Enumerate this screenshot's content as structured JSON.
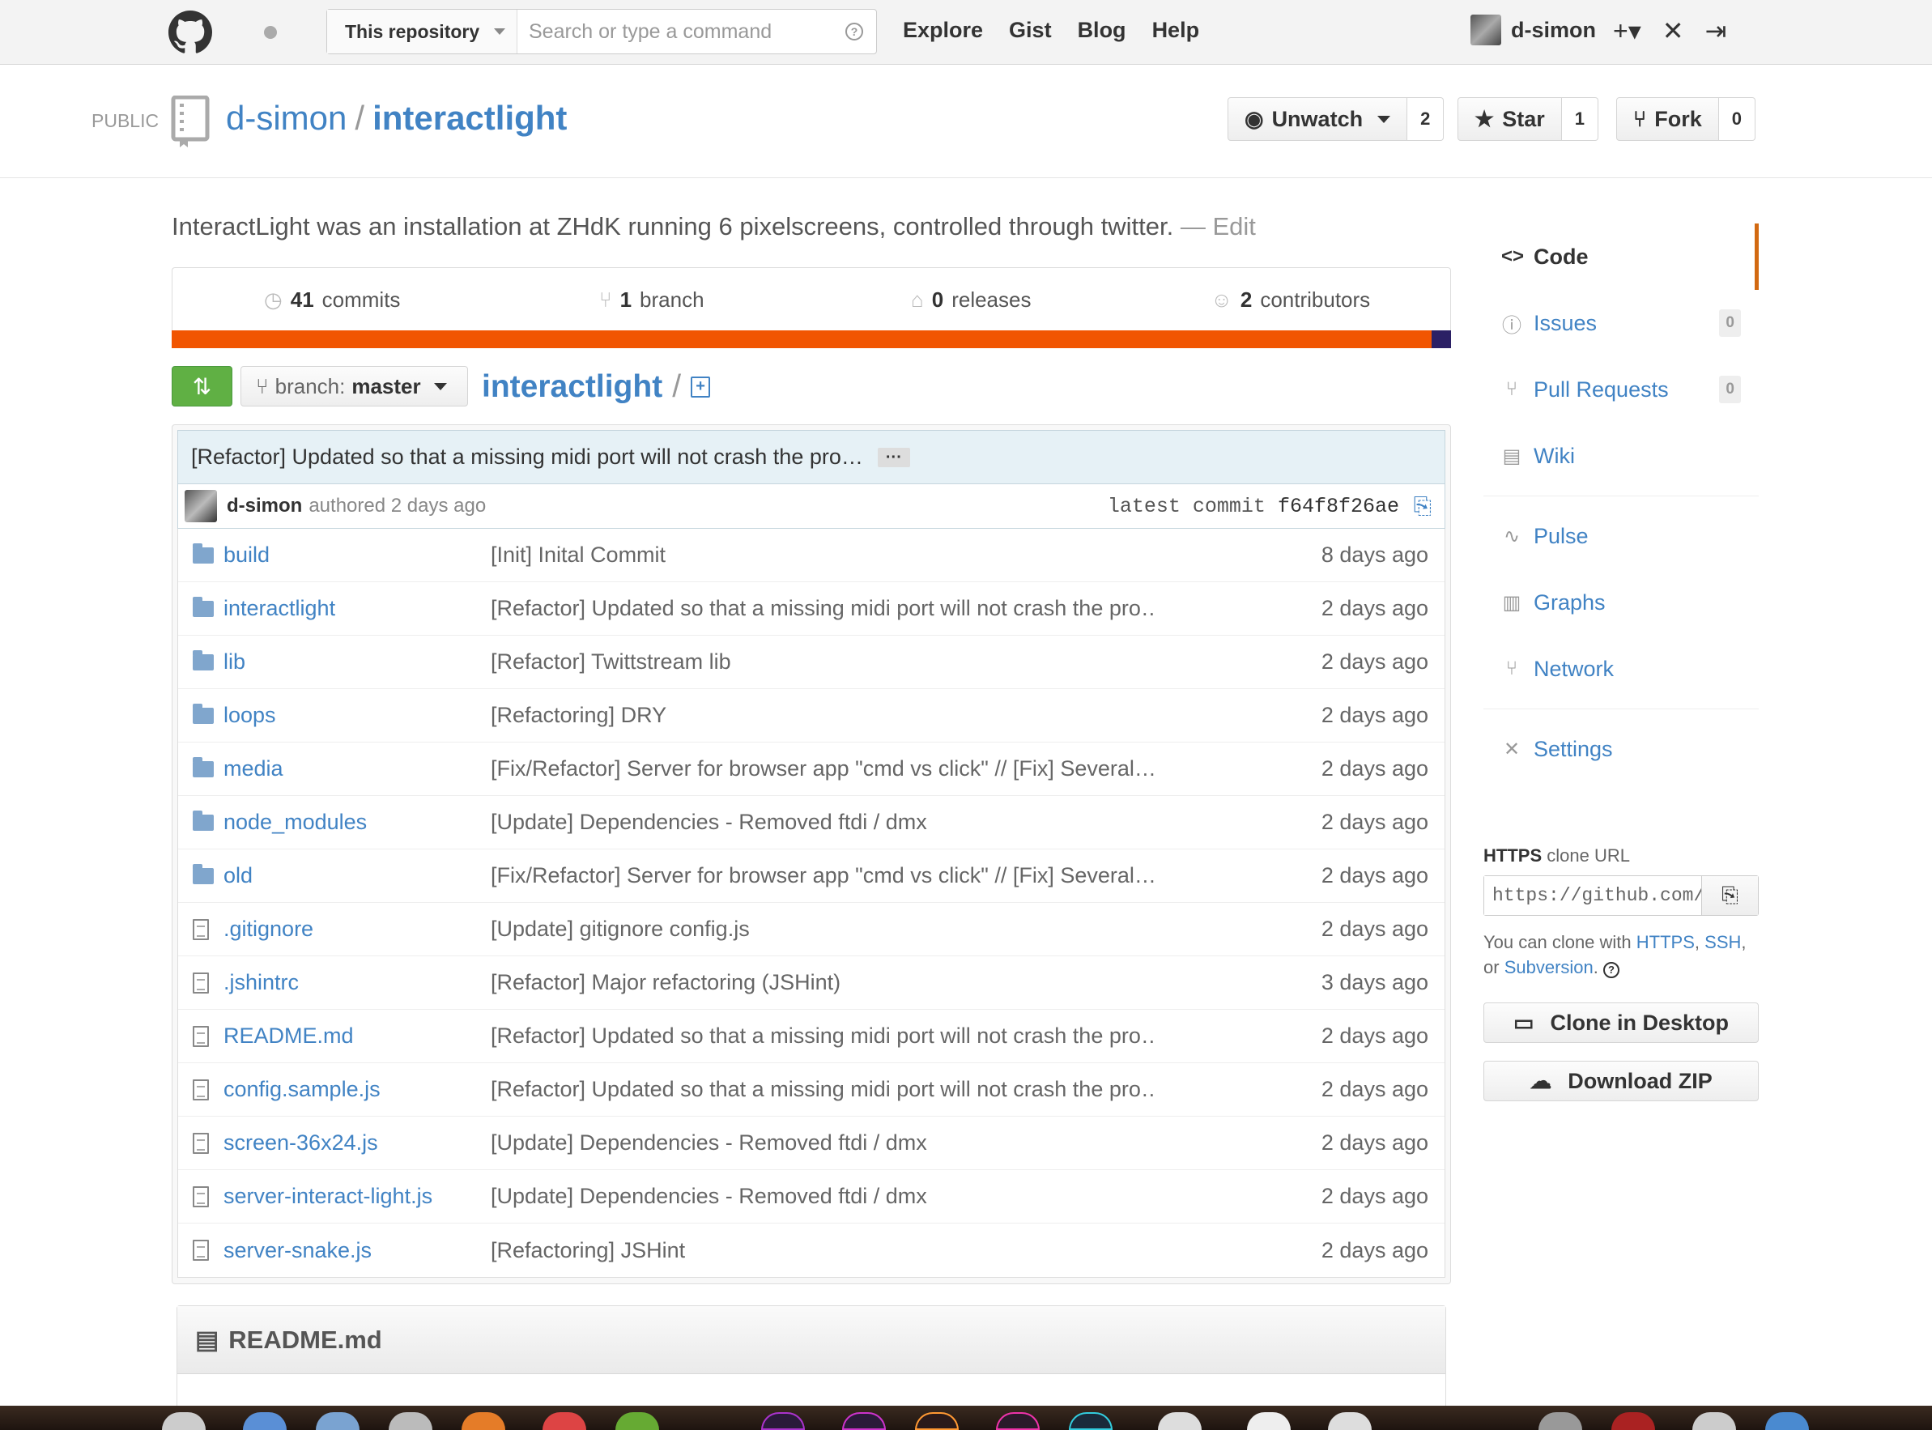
{
  "header": {
    "search_scope": "This repository",
    "search_placeholder": "Search or type a command",
    "search_help": "?",
    "nav": [
      "Explore",
      "Gist",
      "Blog",
      "Help"
    ],
    "username": "d-simon"
  },
  "repo": {
    "visibility": "PUBLIC",
    "owner": "d-simon",
    "separator": "/",
    "name": "interactlight",
    "unwatch_label": "Unwatch",
    "watch_count": "2",
    "star_label": "Star",
    "star_count": "1",
    "fork_label": "Fork",
    "fork_count": "0",
    "description": "InteractLight was an installation at ZHdK running 6 pixelscreens, controlled through twitter.",
    "edit_label": "— Edit"
  },
  "stats": [
    {
      "count": "41",
      "label": "commits"
    },
    {
      "count": "1",
      "label": "branch"
    },
    {
      "count": "0",
      "label": "releases"
    },
    {
      "count": "2",
      "label": "contributors"
    }
  ],
  "colors": {
    "language_primary": "#f15501",
    "language_secondary": "#2b2065",
    "accent": "#4183c4",
    "compare_green": "#60b044",
    "selected_nav": "#d26911"
  },
  "filenav": {
    "branch_prefix": "branch:",
    "branch": "master",
    "breadcrumb_root": "interactlight",
    "breadcrumb_sep": "/"
  },
  "latest_commit": {
    "message": "[Refactor] Updated so that a missing midi port will not crash the pro…",
    "ellipsis": "···",
    "author": "d-simon",
    "authored": "authored 2 days ago",
    "latest_label": "latest commit",
    "sha": "f64f8f26ae"
  },
  "files": [
    {
      "type": "dir",
      "name": "build",
      "message": "[Init] Inital Commit",
      "age": "8 days ago"
    },
    {
      "type": "dir",
      "name": "interactlight",
      "message": "[Refactor] Updated so that a missing midi port will not crash the pro…",
      "age": "2 days ago"
    },
    {
      "type": "dir",
      "name": "lib",
      "message": "[Refactor] Twittstream lib",
      "age": "2 days ago"
    },
    {
      "type": "dir",
      "name": "loops",
      "message": "[Refactoring] DRY",
      "age": "2 days ago"
    },
    {
      "type": "dir",
      "name": "media",
      "message": "[Fix/Refactor] Server for browser app \"cmd vs click\" // [Fix] Several…",
      "age": "2 days ago"
    },
    {
      "type": "dir",
      "name": "node_modules",
      "message": "[Update] Dependencies - Removed ftdi / dmx",
      "age": "2 days ago"
    },
    {
      "type": "dir",
      "name": "old",
      "message": "[Fix/Refactor] Server for browser app \"cmd vs click\" // [Fix] Several…",
      "age": "2 days ago"
    },
    {
      "type": "file",
      "name": ".gitignore",
      "message": "[Update] gitignore config.js",
      "age": "2 days ago"
    },
    {
      "type": "file",
      "name": ".jshintrc",
      "message": "[Refactor] Major refactoring (JSHint)",
      "age": "3 days ago"
    },
    {
      "type": "file",
      "name": "README.md",
      "message": "[Refactor] Updated so that a missing midi port will not crash the pro…",
      "age": "2 days ago"
    },
    {
      "type": "file",
      "name": "config.sample.js",
      "message": "[Refactor] Updated so that a missing midi port will not crash the pro…",
      "age": "2 days ago"
    },
    {
      "type": "file",
      "name": "screen-36x24.js",
      "message": "[Update] Dependencies - Removed ftdi / dmx",
      "age": "2 days ago"
    },
    {
      "type": "file",
      "name": "server-interact-light.js",
      "message": "[Update] Dependencies - Removed ftdi / dmx",
      "age": "2 days ago"
    },
    {
      "type": "file",
      "name": "server-snake.js",
      "message": "[Refactoring] JSHint",
      "age": "2 days ago"
    }
  ],
  "readme": {
    "title": "README.md"
  },
  "sidebar": {
    "code": "Code",
    "issues": "Issues",
    "issues_count": "0",
    "pulls": "Pull Requests",
    "pulls_count": "0",
    "wiki": "Wiki",
    "pulse": "Pulse",
    "graphs": "Graphs",
    "network": "Network",
    "settings": "Settings"
  },
  "clone": {
    "protocol": "HTTPS",
    "label": "clone URL",
    "url": "https://github.com/d-simon/interactlight.git",
    "help_prefix": "You can clone with",
    "https": "HTTPS",
    "ssh": "SSH",
    "or": "or",
    "subversion": "Subversion",
    "clone_desktop": "Clone in Desktop",
    "download_zip": "Download ZIP"
  }
}
